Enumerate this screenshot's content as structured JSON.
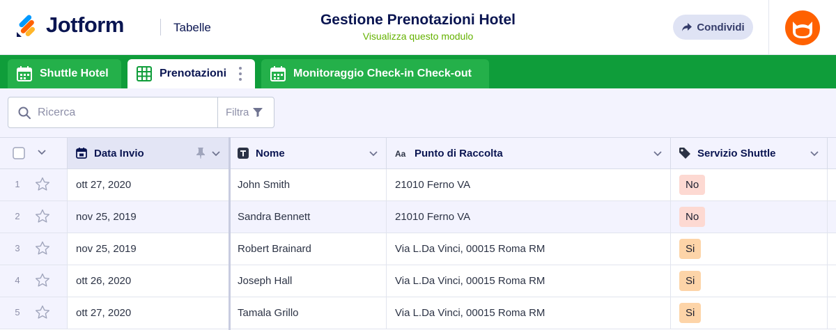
{
  "header": {
    "brand": "Jotform",
    "app_name": "Tabelle",
    "title": "Gestione Prenotazioni Hotel",
    "subtitle": "Visualizza questo modulo",
    "share_label": "Condividi",
    "avatar_icon": "cat-avatar-icon"
  },
  "tabs": [
    {
      "label": "Shuttle Hotel",
      "icon": "calendar-icon",
      "active": false
    },
    {
      "label": "Prenotazioni",
      "icon": "grid-icon",
      "active": true
    },
    {
      "label": "Monitoraggio Check-in Check-out",
      "icon": "calendar-icon",
      "active": false
    }
  ],
  "toolbar": {
    "search_placeholder": "Ricerca",
    "filter_label": "Filtra"
  },
  "table": {
    "columns": [
      {
        "label": "Data Invio",
        "icon": "calendar-date-icon"
      },
      {
        "label": "Nome",
        "icon": "text-icon"
      },
      {
        "label": "Punto di Raccolta",
        "icon": "font-icon"
      },
      {
        "label": "Servizio Shuttle",
        "icon": "tag-icon"
      }
    ],
    "rows": [
      {
        "n": "1",
        "date": "ott 27, 2020",
        "name": "John Smith",
        "pickup": "21010 Ferno VA",
        "shuttle": "No"
      },
      {
        "n": "2",
        "date": "nov 25, 2019",
        "name": "Sandra Bennett",
        "pickup": "21010 Ferno VA",
        "shuttle": "No"
      },
      {
        "n": "3",
        "date": "nov 25, 2019",
        "name": "Robert Brainard",
        "pickup": "Via L.Da Vinci, 00015 Roma RM",
        "shuttle": "Si"
      },
      {
        "n": "4",
        "date": "ott 26, 2020",
        "name": "Joseph Hall",
        "pickup": "Via L.Da Vinci, 00015 Roma RM",
        "shuttle": "Si"
      },
      {
        "n": "5",
        "date": "ott 27, 2020",
        "name": "Tamala Grillo",
        "pickup": "Via L.Da Vinci, 00015 Roma RM",
        "shuttle": "Si"
      }
    ]
  },
  "colors": {
    "brand_navy": "#0a1551",
    "tab_bar_green": "#0f9d3a",
    "subtitle_green": "#64b200",
    "badge_no": "#fdd9d2",
    "badge_si": "#fdd4a8",
    "avatar_orange": "#ff6100"
  }
}
